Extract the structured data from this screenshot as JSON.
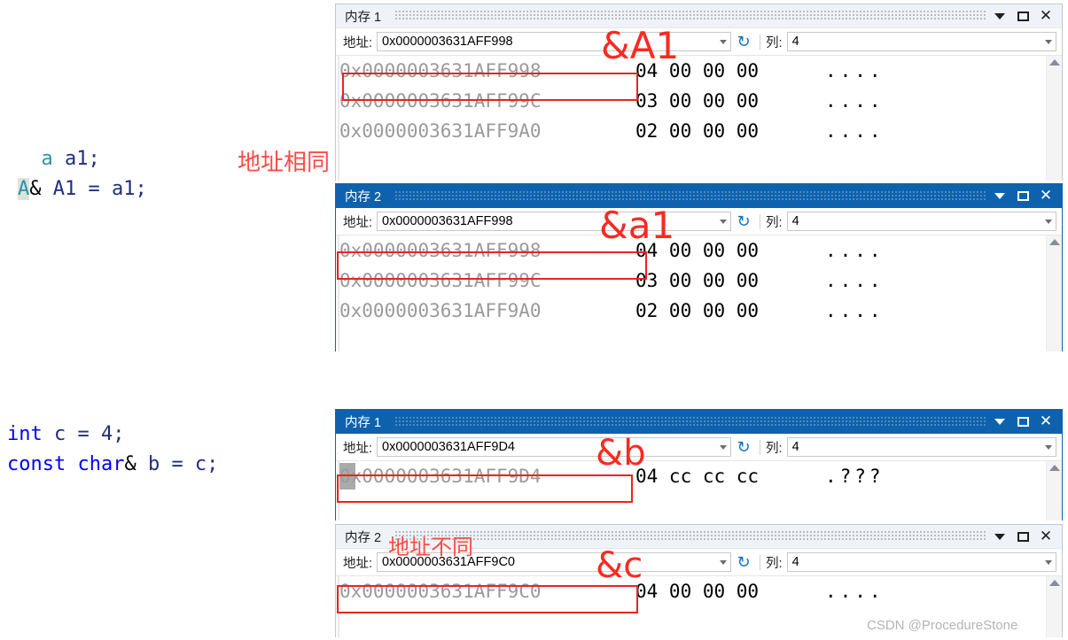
{
  "code_blocks": [
    {
      "name": "reference-alias-snippet",
      "lines": [
        {
          "parts": [
            {
              "text": "  ",
              "style": "plain"
            },
            {
              "text": "a",
              "style": "type"
            },
            {
              "text": " a1;",
              "style": "var"
            }
          ]
        },
        {
          "parts": [
            {
              "text": "A",
              "style": "hl"
            },
            {
              "text": "&",
              "style": "plain"
            },
            {
              "text": " A1 = a1;",
              "style": "var"
            }
          ]
        }
      ]
    },
    {
      "name": "const-char-ref-snippet",
      "lines": [
        {
          "parts": [
            {
              "text": "int",
              "style": "keyword"
            },
            {
              "text": " c = 4;",
              "style": "var"
            }
          ]
        },
        {
          "parts": [
            {
              "text": "const char",
              "style": "keyword"
            },
            {
              "text": "&",
              "style": "plain"
            },
            {
              "text": " b = c;",
              "style": "var"
            }
          ]
        }
      ]
    }
  ],
  "windows": [
    {
      "id": "mem1-top",
      "title": "内存 1",
      "active": false,
      "toolbar": {
        "address_label": "地址:",
        "address_value": "0x0000003631AFF998",
        "refresh_icon": "refresh-icon",
        "columns_label": "列:",
        "columns_value": "4"
      },
      "rows": [
        {
          "address": "0x0000003631AFF998",
          "hex": "04 00 00 00",
          "ascii": "...."
        },
        {
          "address": "0x0000003631AFF99C",
          "hex": "03 00 00 00",
          "ascii": "...."
        },
        {
          "address": "0x0000003631AFF9A0",
          "hex": "02 00 00 00",
          "ascii": "...."
        }
      ]
    },
    {
      "id": "mem2-top",
      "title": "内存 2",
      "active": true,
      "toolbar": {
        "address_label": "地址:",
        "address_value": "0x0000003631AFF998",
        "refresh_icon": "refresh-icon",
        "columns_label": "列:",
        "columns_value": "4"
      },
      "rows": [
        {
          "address": "0x0000003631AFF998",
          "hex": "04 00 00 00",
          "ascii": "...."
        },
        {
          "address": "0x0000003631AFF99C",
          "hex": "03 00 00 00",
          "ascii": "...."
        },
        {
          "address": "0x0000003631AFF9A0",
          "hex": "02 00 00 00",
          "ascii": "...."
        }
      ]
    },
    {
      "id": "mem1-bottom",
      "title": "内存 1",
      "active": true,
      "toolbar": {
        "address_label": "地址:",
        "address_value": "0x0000003631AFF9D4",
        "refresh_icon": "refresh-icon",
        "columns_label": "列:",
        "columns_value": "4"
      },
      "rows": [
        {
          "address": "0x0000003631AFF9D4",
          "hex": "04 cc cc cc",
          "ascii": ".???"
        }
      ]
    },
    {
      "id": "mem2-bottom",
      "title": "内存 2",
      "active": false,
      "toolbar": {
        "address_label": "地址:",
        "address_value": "0x0000003631AFF9C0",
        "refresh_icon": "refresh-icon",
        "columns_label": "列:",
        "columns_value": "4"
      },
      "rows": [
        {
          "address": "0x0000003631AFF9C0",
          "hex": "04 00 00 00",
          "ascii": "...."
        }
      ]
    }
  ],
  "annotations": {
    "amp_A1": "&A1",
    "amp_a1": "&a1",
    "amp_b": "&b",
    "amp_c": "&c",
    "same_address": "地址相同",
    "different_address": "地址不同"
  },
  "watermark": "CSDN @ProcedureStone",
  "colors": {
    "annotation_red": "#fa2a22",
    "active_title_bar": "#0e62ad",
    "inactive_title_bar": "#eff3f8",
    "address_text": "#9a9a9a",
    "keyword_blue": "#0000ff",
    "type_teal": "#2b91af",
    "var_navy": "#1f2f7a",
    "watermark_gray": "#b4b4b4"
  }
}
